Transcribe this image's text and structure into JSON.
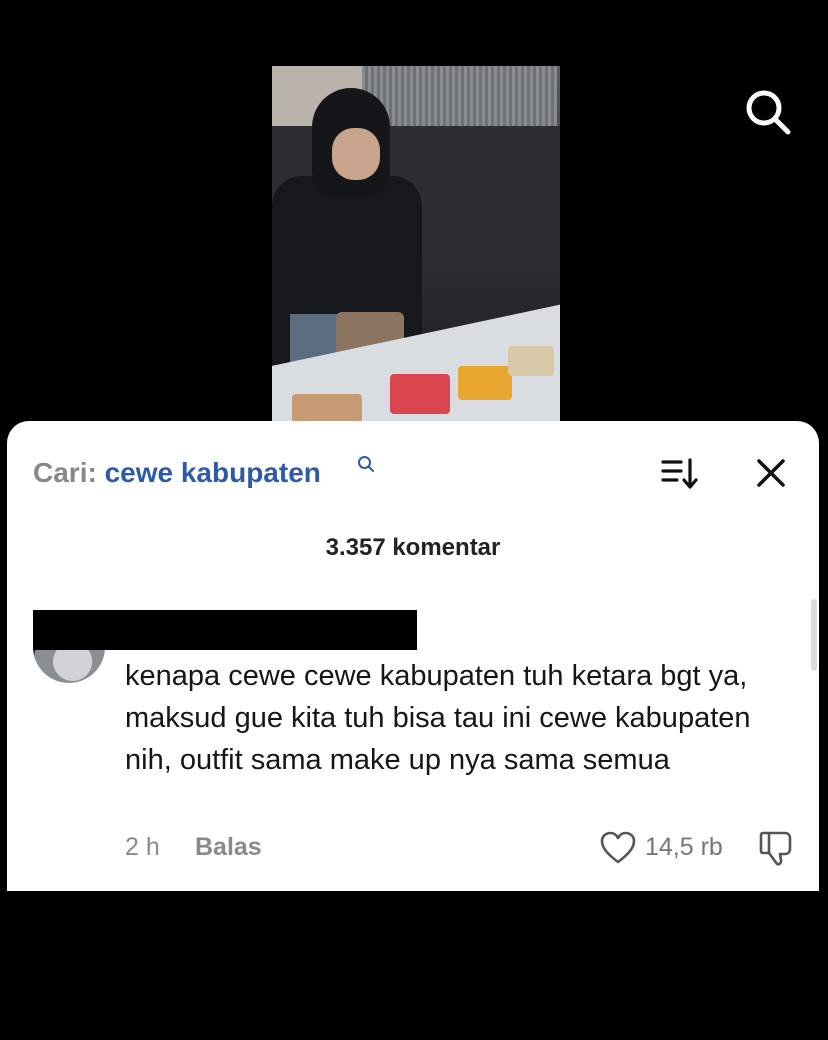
{
  "search_bar": {
    "prefix": "Cari:",
    "query": "cewe kabupaten"
  },
  "comments_header": {
    "count_label": "3.357 komentar"
  },
  "comment": {
    "text": "kenapa cewe cewe kabupaten tuh ketara bgt ya, maksud gue kita tuh bisa tau ini cewe kabupaten nih, outfit sama make up nya sama semua",
    "time": "2 h",
    "reply_label": "Balas",
    "likes": "14,5 rb"
  },
  "icons": {
    "top_search": "search-icon",
    "query_search": "search-icon",
    "sort": "sort-icon",
    "close": "close-icon",
    "like": "heart-icon",
    "dislike": "thumbs-down-icon"
  },
  "colors": {
    "query_link": "#2e5aa8",
    "background": "#000000",
    "panel": "#ffffff"
  }
}
